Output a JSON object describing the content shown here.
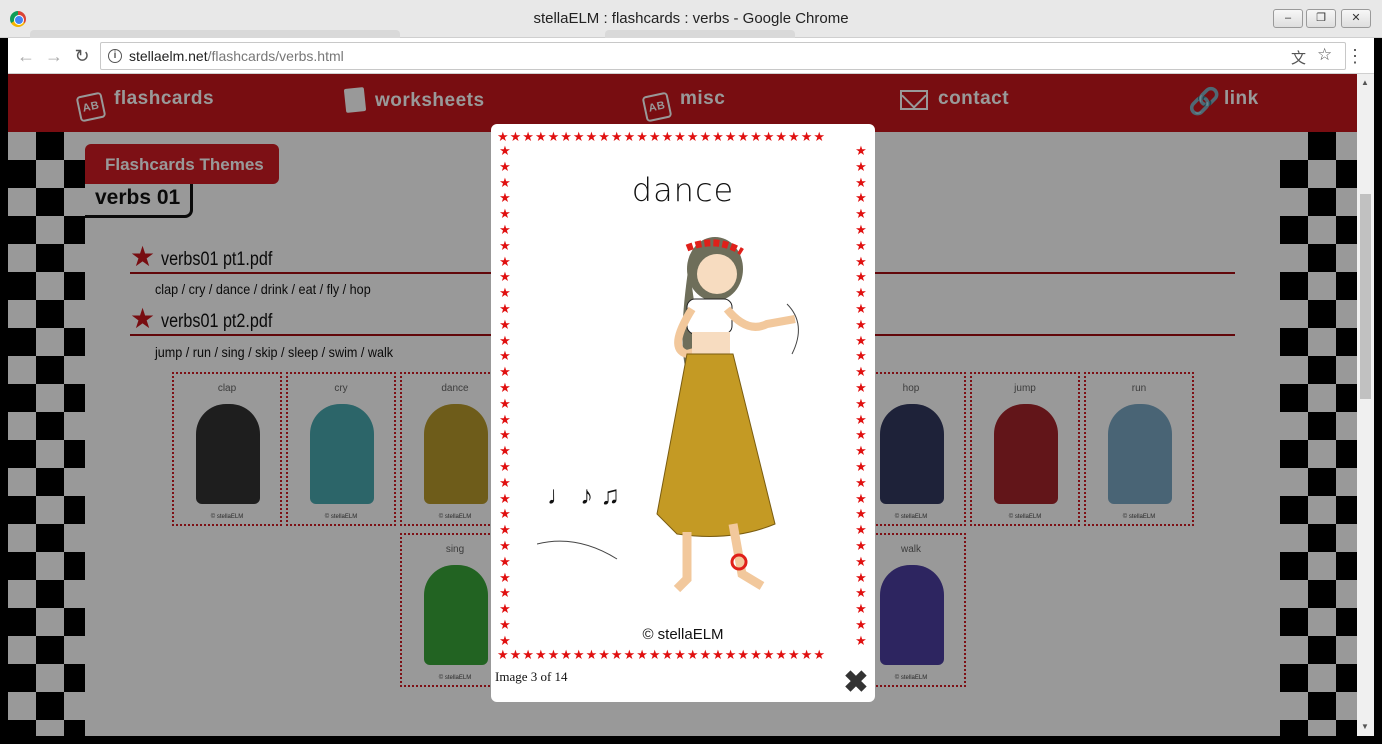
{
  "window": {
    "title": "stellaELM : flashcards : verbs - Google Chrome",
    "minimize": "–",
    "restore": "❐",
    "close": "✕"
  },
  "browser": {
    "url_host": "stellaelm.net",
    "url_path": "/flashcards/verbs.html",
    "back": "←",
    "forward": "→",
    "reload": "↻",
    "info": "i",
    "translate": "文",
    "bookmark": "☆",
    "menu": "⋮"
  },
  "nav": {
    "flashcards": "flashcards",
    "worksheets": "worksheets",
    "misc": "misc",
    "contact": "contact",
    "link": "link"
  },
  "content": {
    "themes_tab": "Flashcards Themes",
    "section_label": "verbs 01",
    "pdfs": [
      {
        "name": "verbs01 pt1.pdf",
        "words": "clap / cry / dance / drink / eat / fly / hop"
      },
      {
        "name": "verbs01 pt2.pdf",
        "words": "jump / run / sing / skip / sleep / swim / walk"
      }
    ],
    "thumbs": [
      "clap",
      "cry",
      "dance",
      "hop",
      "jump",
      "run",
      "sing",
      "walk"
    ],
    "thumb_copyright": "© stellaELM"
  },
  "lightbox": {
    "card_word": "dance",
    "card_copyright": "© stellaELM",
    "caption": "Image 3 of 14",
    "close": "✖"
  }
}
